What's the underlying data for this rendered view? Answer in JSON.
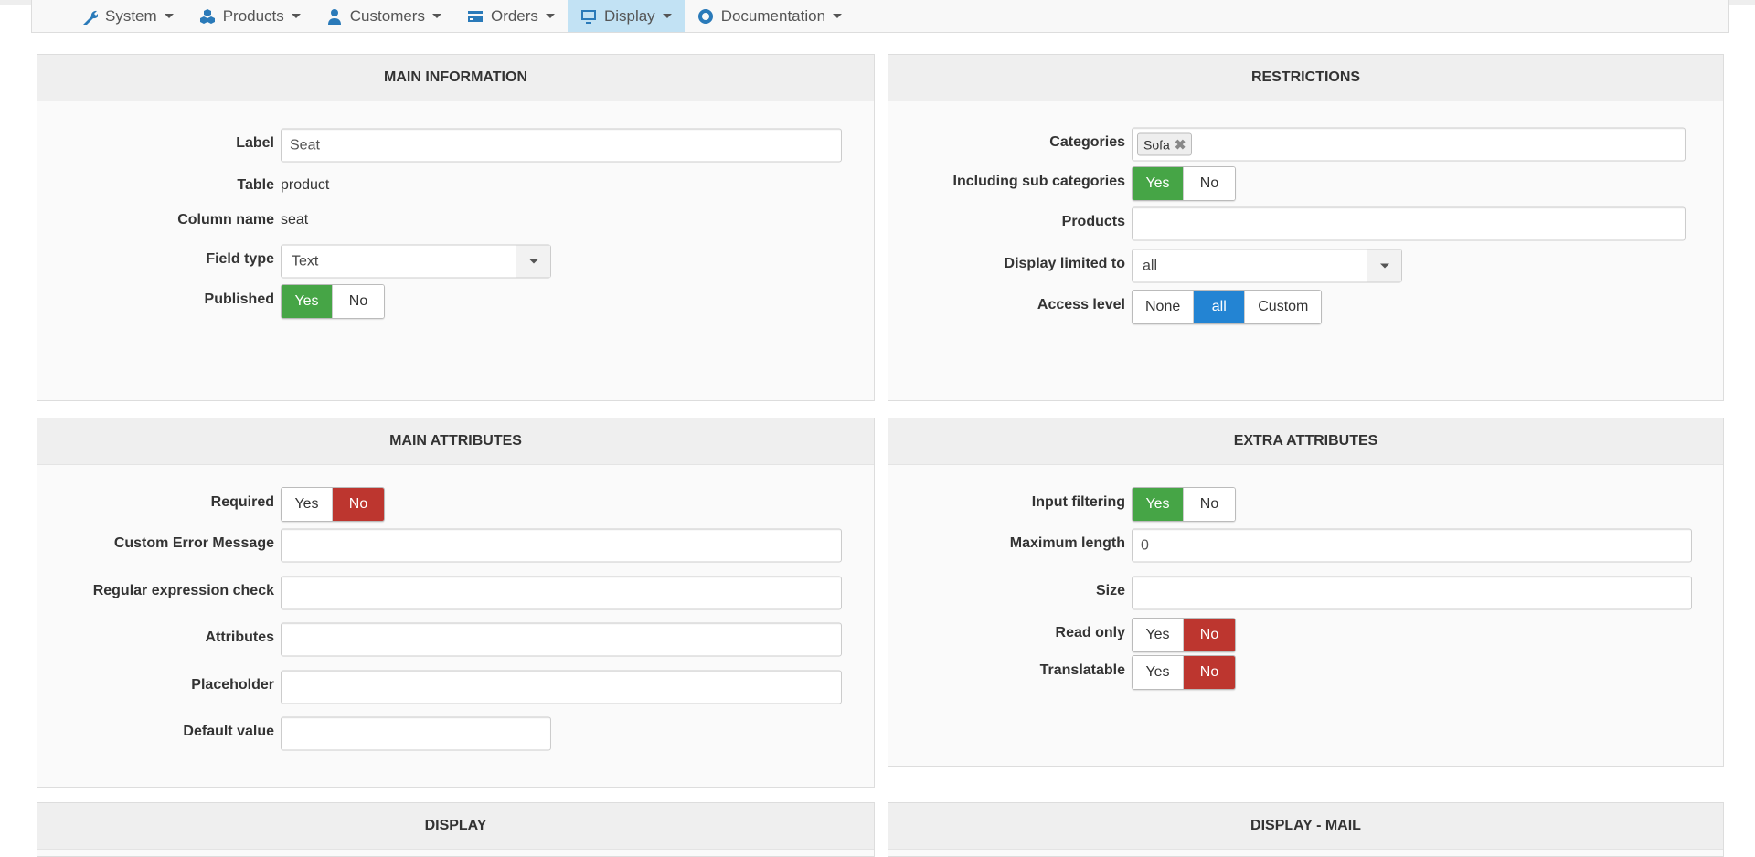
{
  "nav": [
    {
      "label": "System",
      "icon": "wrench-icon"
    },
    {
      "label": "Products",
      "icon": "cubes-icon"
    },
    {
      "label": "Customers",
      "icon": "user-icon"
    },
    {
      "label": "Orders",
      "icon": "credit-card-icon"
    },
    {
      "label": "Display",
      "icon": "monitor-icon",
      "active": true
    },
    {
      "label": "Documentation",
      "icon": "lifebuoy-icon"
    }
  ],
  "colors": {
    "green": "#46a546",
    "red": "#bd362f",
    "blue": "#2384d3",
    "nav_active": "#c2e2f4"
  },
  "panels": [
    {
      "title": "MAIN INFORMATION",
      "fields": [
        {
          "label": "Label",
          "type": "input",
          "value": "Seat"
        },
        {
          "label": "Table",
          "type": "text",
          "value": "product"
        },
        {
          "label": "Column name",
          "type": "text",
          "value": "seat"
        },
        {
          "label": "Field type",
          "type": "select",
          "value": "Text"
        },
        {
          "label": "Published",
          "type": "toggle",
          "options": [
            "Yes",
            "No"
          ],
          "active": "Yes",
          "active_color": "green"
        }
      ]
    },
    {
      "title": "RESTRICTIONS",
      "fields": [
        {
          "label": "Categories",
          "type": "tags",
          "tags": [
            "Sofa"
          ]
        },
        {
          "label": "Including sub categories",
          "type": "toggle",
          "options": [
            "Yes",
            "No"
          ],
          "active": "Yes",
          "active_color": "green"
        },
        {
          "label": "Products",
          "type": "input",
          "value": ""
        },
        {
          "label": "Display limited to",
          "type": "select",
          "value": "all"
        },
        {
          "label": "Access level",
          "type": "toggle",
          "options": [
            "None",
            "all",
            "Custom"
          ],
          "active": "all",
          "active_color": "blue"
        }
      ]
    },
    {
      "title": "MAIN ATTRIBUTES",
      "fields": [
        {
          "label": "Required",
          "type": "toggle",
          "options": [
            "Yes",
            "No"
          ],
          "active": "No",
          "active_color": "red"
        },
        {
          "label": "Custom Error Message",
          "type": "input",
          "value": ""
        },
        {
          "label": "Regular expression check",
          "type": "input",
          "value": ""
        },
        {
          "label": "Attributes",
          "type": "input",
          "value": ""
        },
        {
          "label": "Placeholder",
          "type": "input",
          "value": ""
        },
        {
          "label": "Default value",
          "type": "input-short",
          "value": ""
        }
      ]
    },
    {
      "title": "EXTRA ATTRIBUTES",
      "fields": [
        {
          "label": "Input filtering",
          "type": "toggle",
          "options": [
            "Yes",
            "No"
          ],
          "active": "Yes",
          "active_color": "green"
        },
        {
          "label": "Maximum length",
          "type": "input",
          "value": "0"
        },
        {
          "label": "Size",
          "type": "input",
          "value": ""
        },
        {
          "label": "Read only",
          "type": "toggle",
          "options": [
            "Yes",
            "No"
          ],
          "active": "No",
          "active_color": "red"
        },
        {
          "label": "Translatable",
          "type": "toggle",
          "options": [
            "Yes",
            "No"
          ],
          "active": "No",
          "active_color": "red"
        }
      ]
    },
    {
      "title": "DISPLAY",
      "fields": []
    },
    {
      "title": "DISPLAY - MAIL",
      "fields": []
    }
  ]
}
